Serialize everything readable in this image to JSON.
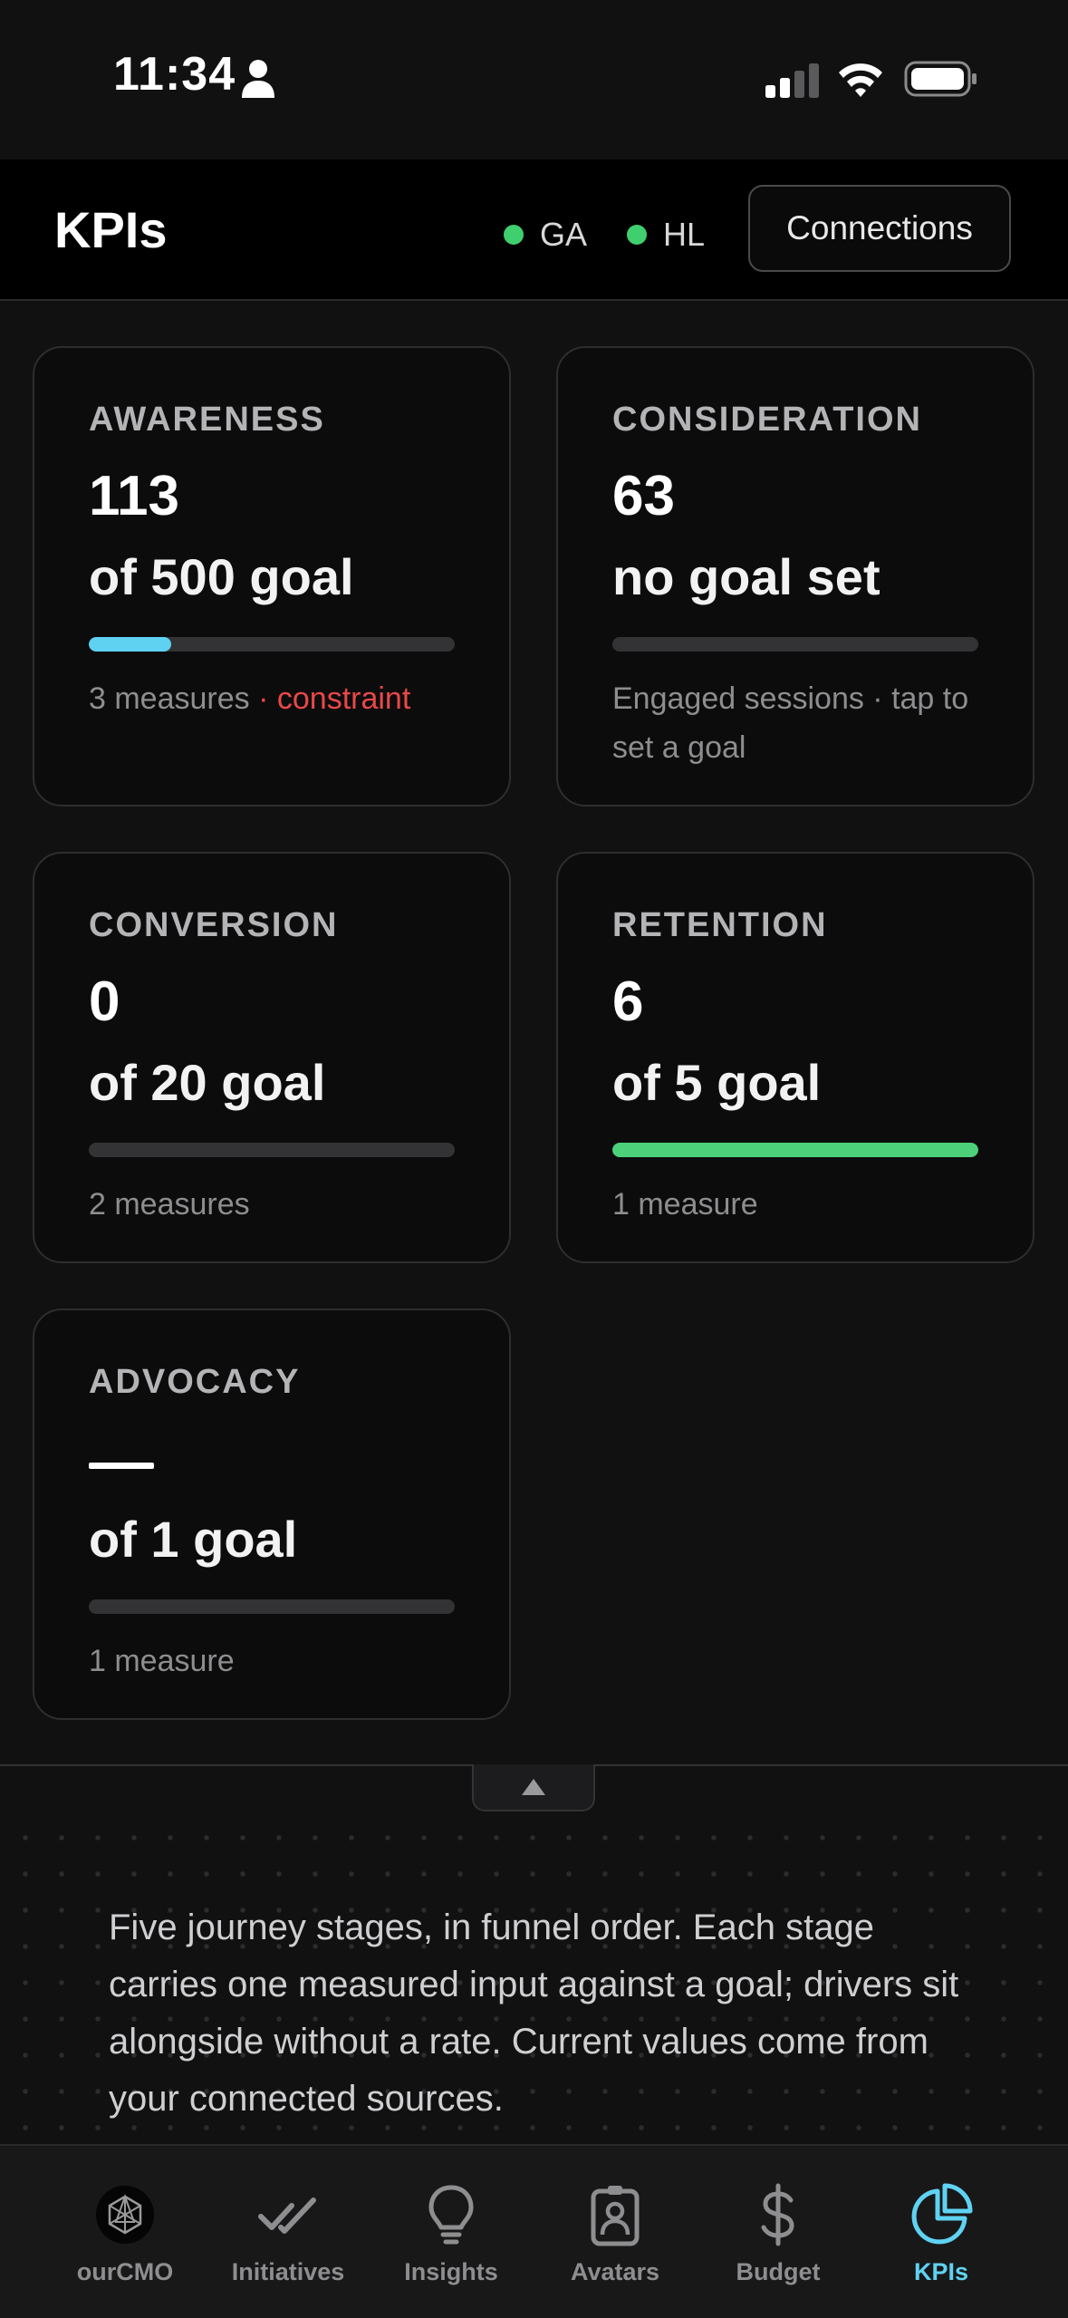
{
  "status_bar": {
    "time": "11:34"
  },
  "header": {
    "title": "KPIs",
    "sources": [
      {
        "label": "GA",
        "status_color": "#3fcf6e"
      },
      {
        "label": "HL",
        "status_color": "#3fcf6e"
      }
    ],
    "connections_label": "Connections"
  },
  "cards": [
    {
      "stage": "AWARENESS",
      "value": "113",
      "goal": "of 500 goal",
      "progress": 0.226,
      "bar_color": "#5fd2f2",
      "measures": "3 measures",
      "flag": "constraint"
    },
    {
      "stage": "CONSIDERATION",
      "value": "63",
      "goal": "no goal set",
      "progress": 0,
      "measures": "Engaged sessions · tap to set a goal"
    },
    {
      "stage": "CONVERSION",
      "value": "0",
      "goal": "of 20 goal",
      "progress": 0,
      "measures": "2 measures"
    },
    {
      "stage": "RETENTION",
      "value": "6",
      "goal": "of 5 goal",
      "progress": 1.0,
      "bar_color": "#4cd17a",
      "measures": "1 measure"
    },
    {
      "stage": "ADVOCACY",
      "value": "—",
      "goal": "of 1 goal",
      "progress": 0,
      "measures": "1 measure"
    }
  ],
  "description": "Five journey stages, in funnel order. Each stage carries one measured input against a goal; drivers sit alongside without a rate. Current values come from your connected sources.",
  "tabs": [
    {
      "label": "ourCMO",
      "icon": "ourcmo-logo-icon",
      "active": false
    },
    {
      "label": "Initiatives",
      "icon": "double-check-icon",
      "active": false
    },
    {
      "label": "Insights",
      "icon": "lightbulb-icon",
      "active": false
    },
    {
      "label": "Avatars",
      "icon": "id-badge-icon",
      "active": false
    },
    {
      "label": "Budget",
      "icon": "dollar-icon",
      "active": false
    },
    {
      "label": "KPIs",
      "icon": "pie-chart-icon",
      "active": true
    }
  ],
  "colors": {
    "accent": "#5fd2f2",
    "success": "#4cd17a",
    "danger": "#e84848"
  }
}
